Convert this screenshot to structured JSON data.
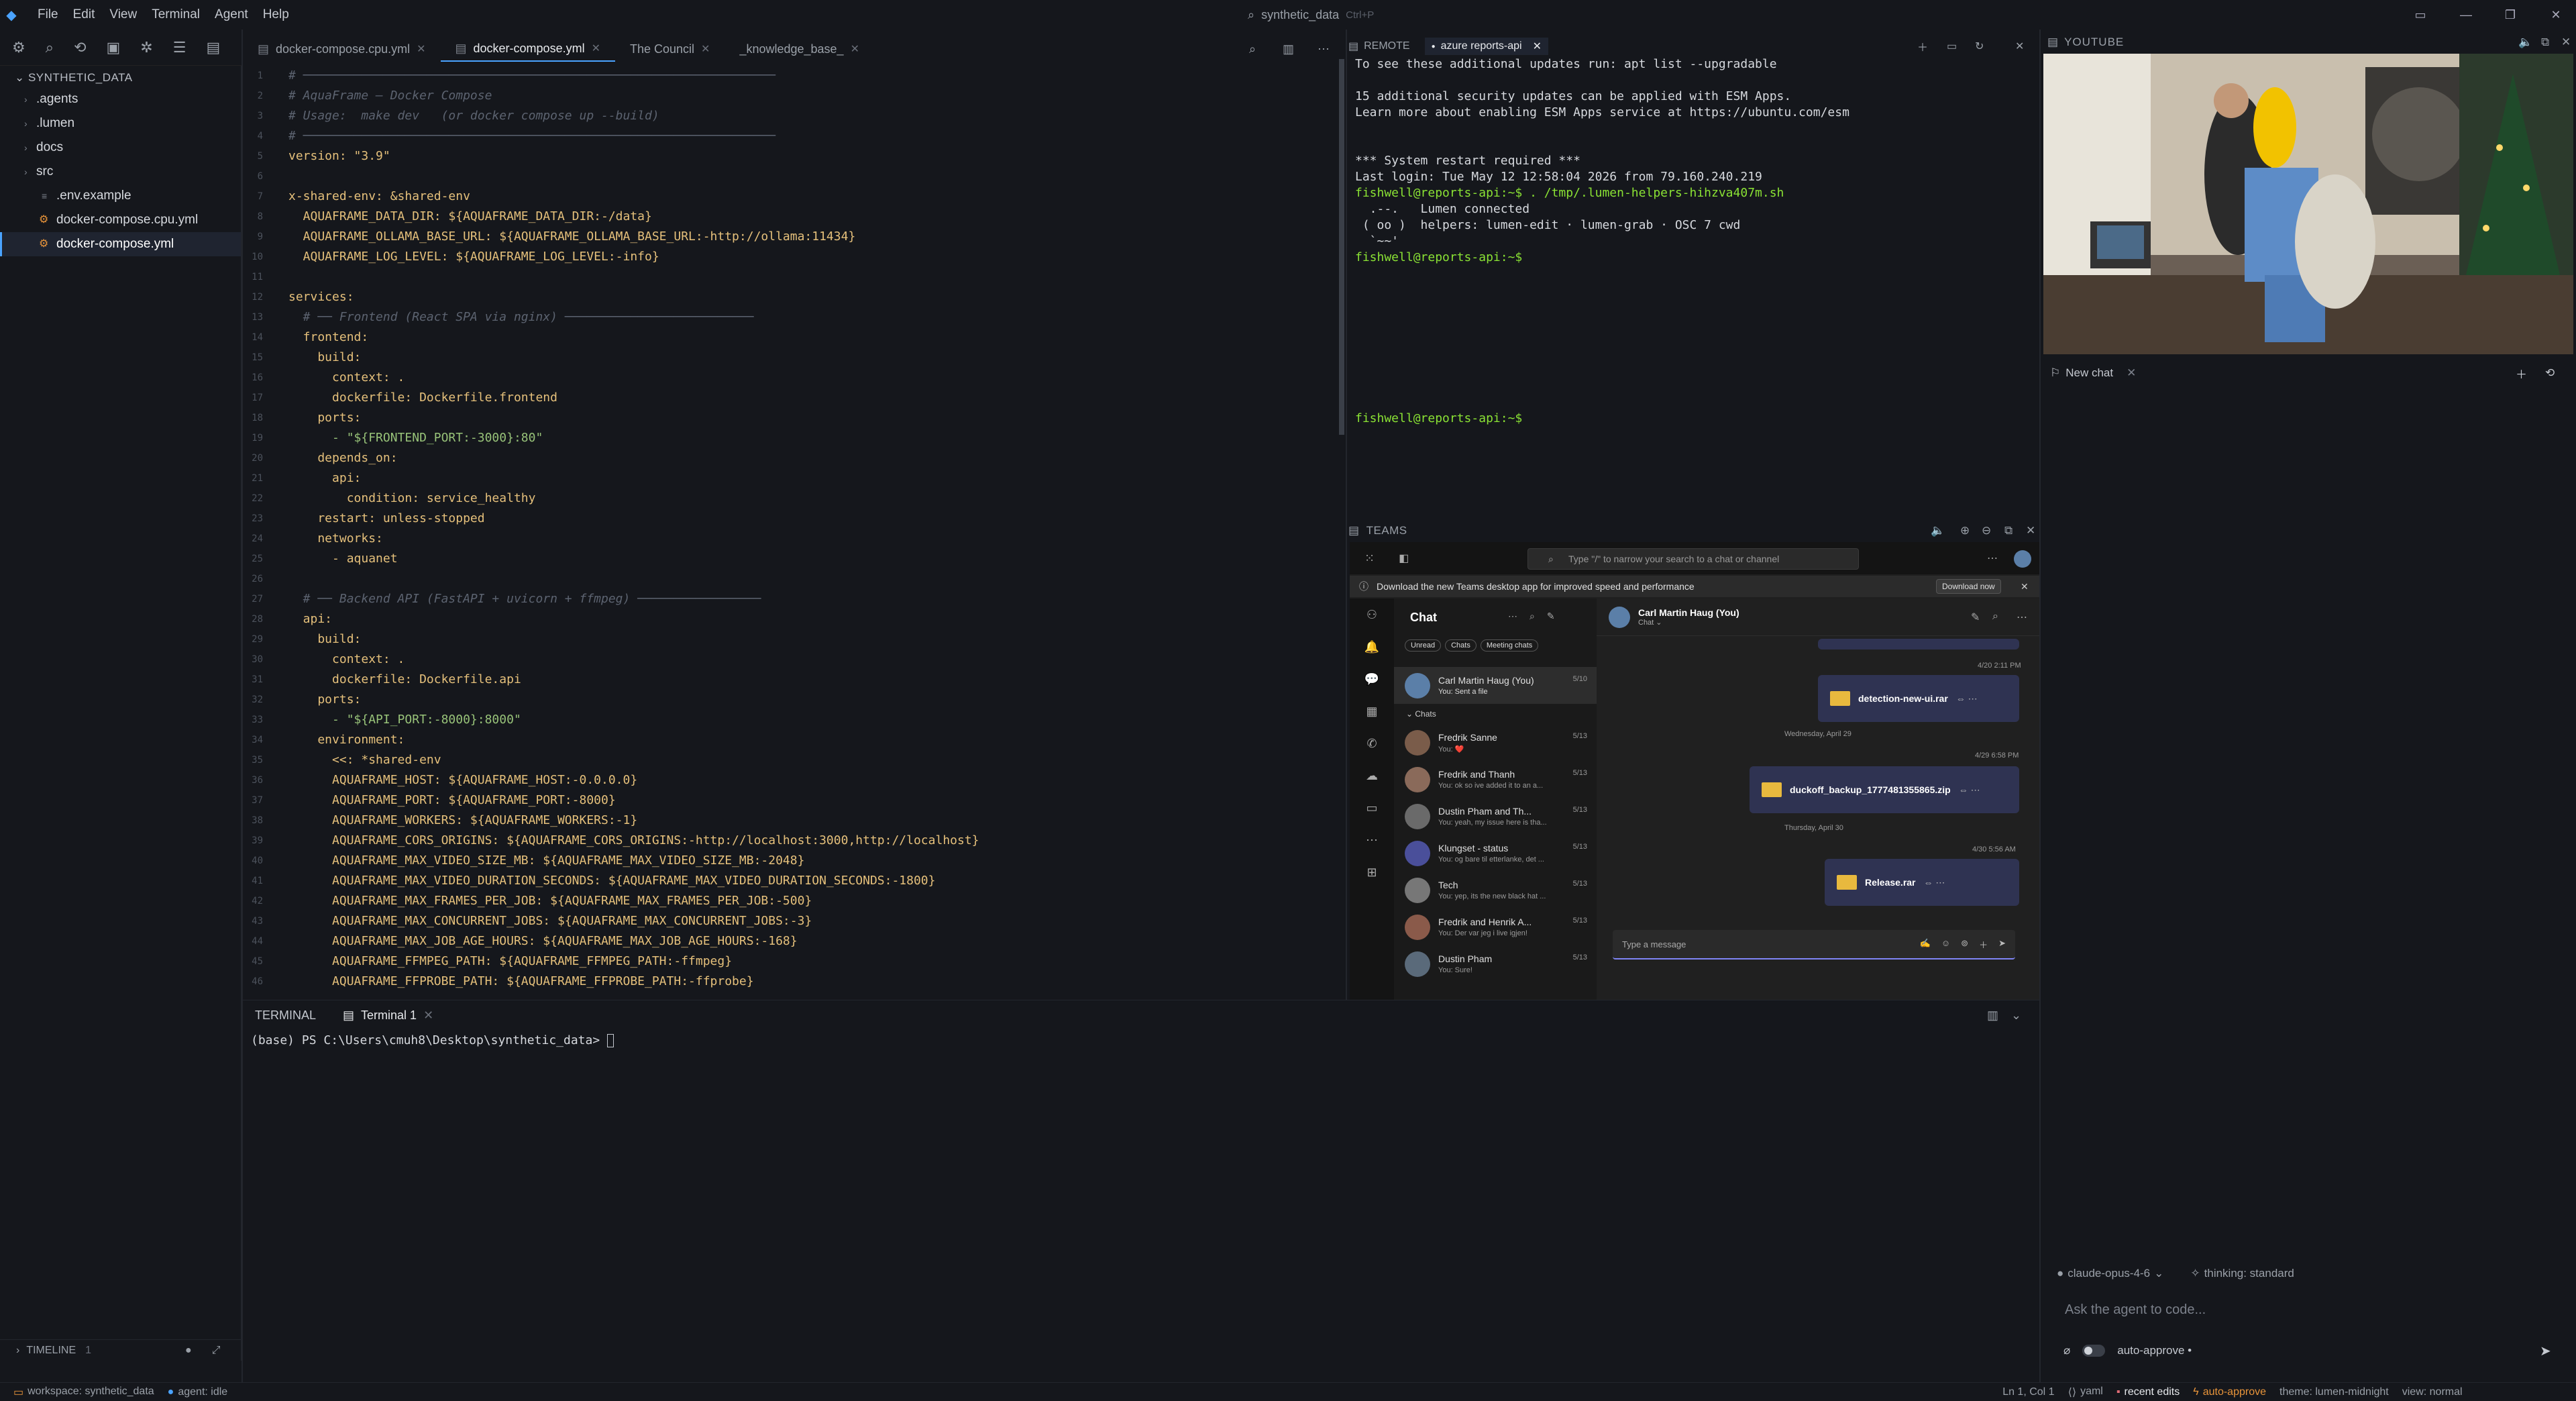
{
  "menu": [
    "File",
    "Edit",
    "View",
    "Terminal",
    "Agent",
    "Help"
  ],
  "command_search": {
    "label": "synthetic_data",
    "shortcut": "Ctrl+P"
  },
  "explorer": {
    "root": "SYNTHETIC_DATA",
    "items": [
      {
        "label": ".agents",
        "type": "folder"
      },
      {
        "label": ".lumen",
        "type": "folder"
      },
      {
        "label": "docs",
        "type": "folder"
      },
      {
        "label": "src",
        "type": "folder"
      },
      {
        "label": ".env.example",
        "type": "file"
      },
      {
        "label": "docker-compose.cpu.yml",
        "type": "file"
      },
      {
        "label": "docker-compose.yml",
        "type": "file",
        "selected": true
      }
    ],
    "timeline": {
      "label": "TIMELINE",
      "count": "1"
    }
  },
  "editor_tabs": [
    "docker-compose.cpu.yml",
    "docker-compose.yml",
    "The Council",
    "_knowledge_base_"
  ],
  "code_lines": [
    {
      "n": "1",
      "t": "# ─────────────────────────────────────────────────────────────────",
      "c": "c"
    },
    {
      "n": "2",
      "t": "# AquaFrame — Docker Compose",
      "c": "c"
    },
    {
      "n": "3",
      "t": "# Usage:  make dev   (or docker compose up --build)",
      "c": "c"
    },
    {
      "n": "4",
      "t": "# ─────────────────────────────────────────────────────────────────",
      "c": "c"
    },
    {
      "n": "5",
      "t": "version: \"3.9\"",
      "c": "k"
    },
    {
      "n": "6",
      "t": "",
      "c": "p"
    },
    {
      "n": "7",
      "t": "x-shared-env: &shared-env",
      "c": "k"
    },
    {
      "n": "8",
      "t": "  AQUAFRAME_DATA_DIR: ${AQUAFRAME_DATA_DIR:-/data}",
      "c": "k"
    },
    {
      "n": "9",
      "t": "  AQUAFRAME_OLLAMA_BASE_URL: ${AQUAFRAME_OLLAMA_BASE_URL:-http://ollama:11434}",
      "c": "k"
    },
    {
      "n": "10",
      "t": "  AQUAFRAME_LOG_LEVEL: ${AQUAFRAME_LOG_LEVEL:-info}",
      "c": "k"
    },
    {
      "n": "11",
      "t": "",
      "c": "p"
    },
    {
      "n": "12",
      "t": "services:",
      "c": "k"
    },
    {
      "n": "13",
      "t": "  # ── Frontend (React SPA via nginx) ──────────────────────────",
      "c": "c"
    },
    {
      "n": "14",
      "t": "  frontend:",
      "c": "k"
    },
    {
      "n": "15",
      "t": "    build:",
      "c": "k"
    },
    {
      "n": "16",
      "t": "      context: .",
      "c": "k"
    },
    {
      "n": "17",
      "t": "      dockerfile: Dockerfile.frontend",
      "c": "k"
    },
    {
      "n": "18",
      "t": "    ports:",
      "c": "k"
    },
    {
      "n": "19",
      "t": "      - \"${FRONTEND_PORT:-3000}:80\"",
      "c": "v"
    },
    {
      "n": "20",
      "t": "    depends_on:",
      "c": "k"
    },
    {
      "n": "21",
      "t": "      api:",
      "c": "k"
    },
    {
      "n": "22",
      "t": "        condition: service_healthy",
      "c": "k"
    },
    {
      "n": "23",
      "t": "    restart: unless-stopped",
      "c": "k"
    },
    {
      "n": "24",
      "t": "    networks:",
      "c": "k"
    },
    {
      "n": "25",
      "t": "      - aquanet",
      "c": "k"
    },
    {
      "n": "26",
      "t": "",
      "c": "p"
    },
    {
      "n": "27",
      "t": "  # ── Backend API (FastAPI + uvicorn + ffmpeg) ─────────────────",
      "c": "c"
    },
    {
      "n": "28",
      "t": "  api:",
      "c": "k"
    },
    {
      "n": "29",
      "t": "    build:",
      "c": "k"
    },
    {
      "n": "30",
      "t": "      context: .",
      "c": "k"
    },
    {
      "n": "31",
      "t": "      dockerfile: Dockerfile.api",
      "c": "k"
    },
    {
      "n": "32",
      "t": "    ports:",
      "c": "k"
    },
    {
      "n": "33",
      "t": "      - \"${API_PORT:-8000}:8000\"",
      "c": "v"
    },
    {
      "n": "34",
      "t": "    environment:",
      "c": "k"
    },
    {
      "n": "35",
      "t": "      <<: *shared-env",
      "c": "k"
    },
    {
      "n": "36",
      "t": "      AQUAFRAME_HOST: ${AQUAFRAME_HOST:-0.0.0.0}",
      "c": "k"
    },
    {
      "n": "37",
      "t": "      AQUAFRAME_PORT: ${AQUAFRAME_PORT:-8000}",
      "c": "k"
    },
    {
      "n": "38",
      "t": "      AQUAFRAME_WORKERS: ${AQUAFRAME_WORKERS:-1}",
      "c": "k"
    },
    {
      "n": "39",
      "t": "      AQUAFRAME_CORS_ORIGINS: ${AQUAFRAME_CORS_ORIGINS:-http://localhost:3000,http://localhost}",
      "c": "k"
    },
    {
      "n": "40",
      "t": "      AQUAFRAME_MAX_VIDEO_SIZE_MB: ${AQUAFRAME_MAX_VIDEO_SIZE_MB:-2048}",
      "c": "k"
    },
    {
      "n": "41",
      "t": "      AQUAFRAME_MAX_VIDEO_DURATION_SECONDS: ${AQUAFRAME_MAX_VIDEO_DURATION_SECONDS:-1800}",
      "c": "k"
    },
    {
      "n": "42",
      "t": "      AQUAFRAME_MAX_FRAMES_PER_JOB: ${AQUAFRAME_MAX_FRAMES_PER_JOB:-500}",
      "c": "k"
    },
    {
      "n": "43",
      "t": "      AQUAFRAME_MAX_CONCURRENT_JOBS: ${AQUAFRAME_MAX_CONCURRENT_JOBS:-3}",
      "c": "k"
    },
    {
      "n": "44",
      "t": "      AQUAFRAME_MAX_JOB_AGE_HOURS: ${AQUAFRAME_MAX_JOB_AGE_HOURS:-168}",
      "c": "k"
    },
    {
      "n": "45",
      "t": "      AQUAFRAME_FFMPEG_PATH: ${AQUAFRAME_FFMPEG_PATH:-ffmpeg}",
      "c": "k"
    },
    {
      "n": "46",
      "t": "      AQUAFRAME_FFPROBE_PATH: ${AQUAFRAME_FFPROBE_PATH:-ffprobe}",
      "c": "k"
    }
  ],
  "terminal": {
    "title": "TERMINAL",
    "tab": "Terminal 1",
    "prompt": "(base) PS C:\\Users\\cmuh8\\Desktop\\synthetic_data> "
  },
  "remote": {
    "label": "REMOTE",
    "tab": "azure reports-api",
    "lines": [
      {
        "t": "To see these additional updates run: apt list --upgradable",
        "p": false
      },
      {
        "t": "",
        "p": false
      },
      {
        "t": "15 additional security updates can be applied with ESM Apps.",
        "p": false
      },
      {
        "t": "Learn more about enabling ESM Apps service at https://ubuntu.com/esm",
        "p": false
      },
      {
        "t": "",
        "p": false
      },
      {
        "t": "",
        "p": false
      },
      {
        "t": "*** System restart required ***",
        "p": false
      },
      {
        "t": "Last login: Tue May 12 12:58:04 2026 from 79.160.240.219",
        "p": false
      },
      {
        "t": "fishwell@reports-api:~$ . /tmp/.lumen-helpers-hihzva407m.sh",
        "p": true
      },
      {
        "t": "  .--.   Lumen connected",
        "p": false
      },
      {
        "t": " ( oo )  helpers: lumen-edit · lumen-grab · OSC 7 cwd",
        "p": false
      },
      {
        "t": "  `~~'",
        "p": false
      },
      {
        "t": "fishwell@reports-api:~$",
        "p": true
      },
      {
        "t": "",
        "p": false
      },
      {
        "t": "",
        "p": false
      },
      {
        "t": "",
        "p": false
      },
      {
        "t": "",
        "p": false
      },
      {
        "t": "",
        "p": false
      },
      {
        "t": "",
        "p": false
      },
      {
        "t": "",
        "p": false
      },
      {
        "t": "",
        "p": false
      },
      {
        "t": "",
        "p": false
      },
      {
        "t": "fishwell@reports-api:~$",
        "p": true
      },
      {
        "t": "",
        "p": false
      },
      {
        "t": "",
        "p": false
      },
      {
        "t": "",
        "p": false
      },
      {
        "t": "",
        "p": false
      },
      {
        "t": "",
        "p": false
      },
      {
        "t": "",
        "p": false
      },
      {
        "t": "",
        "p": false
      },
      {
        "t": "",
        "p": false
      },
      {
        "t": "fishwell@reports-api:~$ ",
        "p": true
      }
    ]
  },
  "teams": {
    "label": "TEAMS",
    "search_placeholder": "Type \"/\" to narrow your search to a chat or channel",
    "banner": "Download the new Teams desktop app for improved speed and performance",
    "banner_button": "Download now",
    "chat_title": "Chat",
    "filters": [
      "Unread",
      "Chats",
      "Meeting chats"
    ],
    "pinned": {
      "name": "Carl Martin Haug (You)",
      "preview": "You: Sent a file",
      "date": "5/10"
    },
    "chats_label": "Chats",
    "chats": [
      {
        "name": "Fredrik Sanne",
        "preview": "You: ❤️",
        "date": "5/13"
      },
      {
        "name": "Fredrik and Thanh",
        "preview": "You: ok so ive added it to an a...",
        "date": "5/13"
      },
      {
        "name": "Dustin Pham and Th...",
        "preview": "You: yeah, my issue here is tha...",
        "date": "5/13"
      },
      {
        "name": "Klungset - status",
        "preview": "You: og bare til etterlanke, det ...",
        "date": "5/13"
      },
      {
        "name": "Tech",
        "preview": "You: yep, its the new black hat ...",
        "date": "5/13"
      },
      {
        "name": "Fredrik and Henrik A...",
        "preview": "You: Der var jeg i live igjen!",
        "date": "5/13"
      },
      {
        "name": "Dustin Pham",
        "preview": "You: Sure!",
        "date": "5/13"
      }
    ],
    "conv_name": "Carl Martin Haug (You)",
    "conv_sub": "Chat ⌄",
    "messages": [
      {
        "stamp": "4/20 2:11 PM",
        "file": "detection-new-ui.rar"
      },
      {
        "day": "Wednesday, April 29"
      },
      {
        "stamp": "4/29 6:58 PM",
        "file": "duckoff_backup_1777481355865.zip"
      },
      {
        "day": "Thursday, April 30"
      },
      {
        "stamp": "4/30 5:56 AM",
        "file": "Release.rar"
      }
    ],
    "compose_placeholder": "Type a message"
  },
  "youtube": {
    "label": "YOUTUBE"
  },
  "agent": {
    "tab": "New chat",
    "model": "claude-opus-4-6",
    "thinking": "thinking: standard",
    "input_placeholder": "Ask the agent to code...",
    "auto_approve": "auto-approve •"
  },
  "status": {
    "workspace": "workspace: synthetic_data",
    "agent": "agent: idle",
    "position": "Ln 1, Col 1",
    "lang": "yaml",
    "recent": "recent edits",
    "auto": "auto-approve",
    "theme": "theme: lumen-midnight",
    "view": "view: normal"
  },
  "colors": {
    "accent": "#4aa3ff",
    "prompt": "#8ae234",
    "teams_bg": "#1f1f1f",
    "file_bubble": "#2f3352"
  }
}
